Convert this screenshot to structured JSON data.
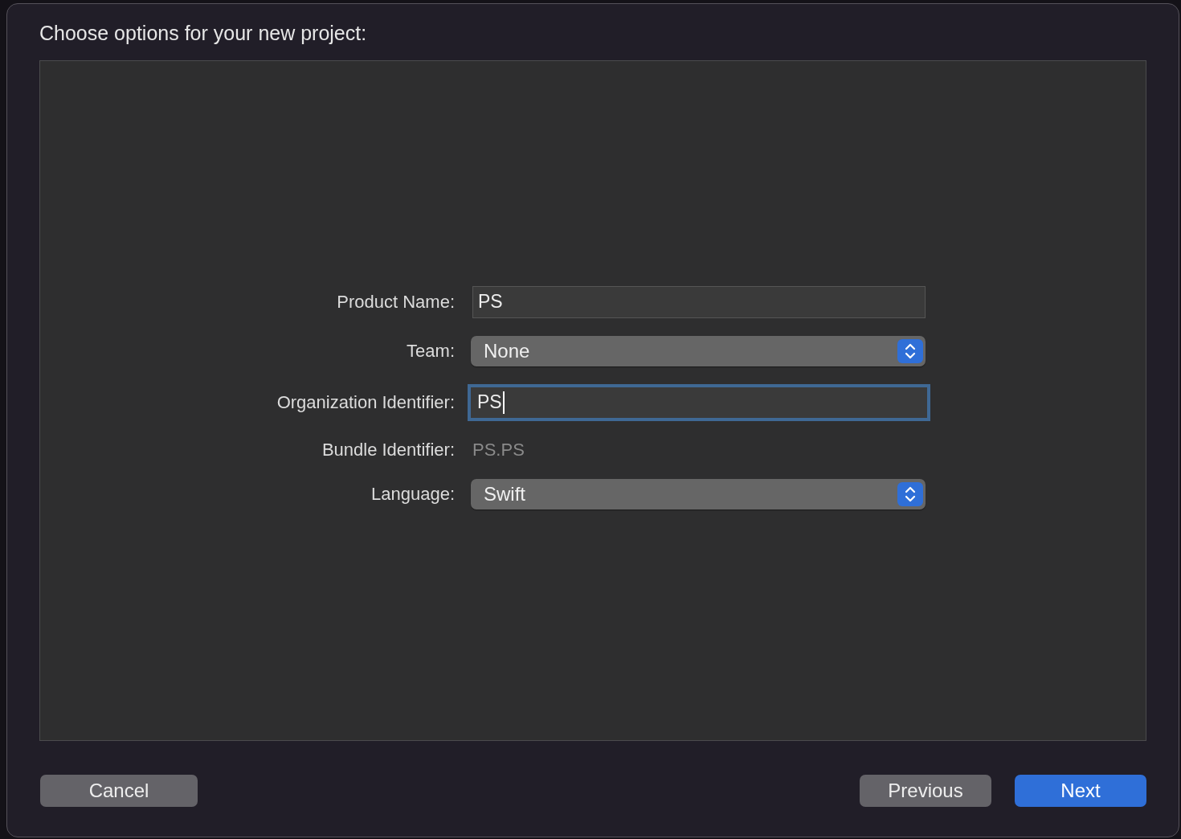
{
  "window": {
    "title": "Choose options for your new project:"
  },
  "fields": [
    {
      "kind": "text-field",
      "label": "Product Name:",
      "value": "PS",
      "focused": false
    },
    {
      "kind": "popup",
      "label": "Team:",
      "value": "None"
    },
    {
      "kind": "text-field",
      "label": "Organization Identifier:",
      "value": "PS",
      "focused": true
    },
    {
      "kind": "static",
      "label": "Bundle Identifier:",
      "value": "PS.PS"
    },
    {
      "kind": "popup",
      "label": "Language:",
      "value": "Swift"
    }
  ],
  "left_buttons": [
    {
      "label": "Cancel",
      "primary": false
    }
  ],
  "right_buttons": [
    {
      "label": "Previous",
      "primary": false
    },
    {
      "label": "Next",
      "primary": true
    }
  ]
}
